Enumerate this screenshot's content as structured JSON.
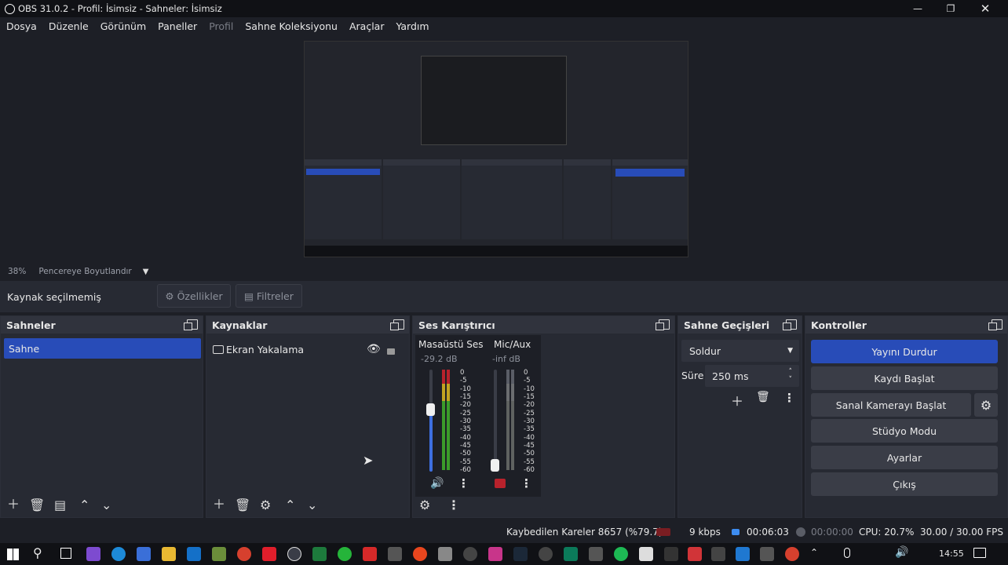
{
  "window": {
    "title": "OBS 31.0.2 - Profil: İsimsiz - Sahneler: İsimsiz"
  },
  "menu": {
    "items": [
      "Dosya",
      "Düzenle",
      "Görünüm",
      "Paneller",
      "Profil",
      "Sahne Koleksiyonu",
      "Araçlar",
      "Yardım"
    ]
  },
  "zoom": {
    "percent": "38%",
    "mode": "Pencereye Boyutlandır"
  },
  "source_bar": {
    "status": "Kaynak seçilmemiş",
    "properties": "Özellikler",
    "filters": "Filtreler"
  },
  "scenes": {
    "title": "Sahneler",
    "items": [
      "Sahne"
    ]
  },
  "sources": {
    "title": "Kaynaklar",
    "items": [
      "Ekran Yakalama"
    ]
  },
  "mixer": {
    "title": "Ses Karıştırıcı",
    "channels": [
      {
        "name": "Masaüstü Ses",
        "level": "-29.2 dB",
        "volume": 0.62
      },
      {
        "name": "Mic/Aux",
        "level": "-inf dB",
        "volume": 0.0
      }
    ],
    "ticks": [
      "0",
      "-5",
      "-10",
      "-15",
      "-20",
      "-25",
      "-30",
      "-35",
      "-40",
      "-45",
      "-50",
      "-55",
      "-60"
    ]
  },
  "transitions": {
    "title": "Sahne Geçişleri",
    "type": "Soldur",
    "duration_label": "Süre",
    "duration": "250 ms"
  },
  "controls": {
    "title": "Kontroller",
    "stop_stream": "Yayını Durdur",
    "start_record": "Kaydı Başlat",
    "start_vcam": "Sanal Kamerayı Başlat",
    "studio_mode": "Stüdyo Modu",
    "settings": "Ayarlar",
    "exit": "Çıkış"
  },
  "status": {
    "dropped": "Kaybedilen Kareler 8657 (%79.7)",
    "bitrate": "9 kbps",
    "stream_time": "00:06:03",
    "rec_time": "00:00:00",
    "cpu": "CPU: 20.7%",
    "fps": "30.00 / 30.00 FPS"
  },
  "taskbar": {
    "time": "14:55"
  },
  "colors": {
    "accent": "#284cb8",
    "dock_bg": "#272a33",
    "header_bg": "#30333d",
    "stream_dot": "#3d8cf0",
    "muted": "#b8222c"
  }
}
